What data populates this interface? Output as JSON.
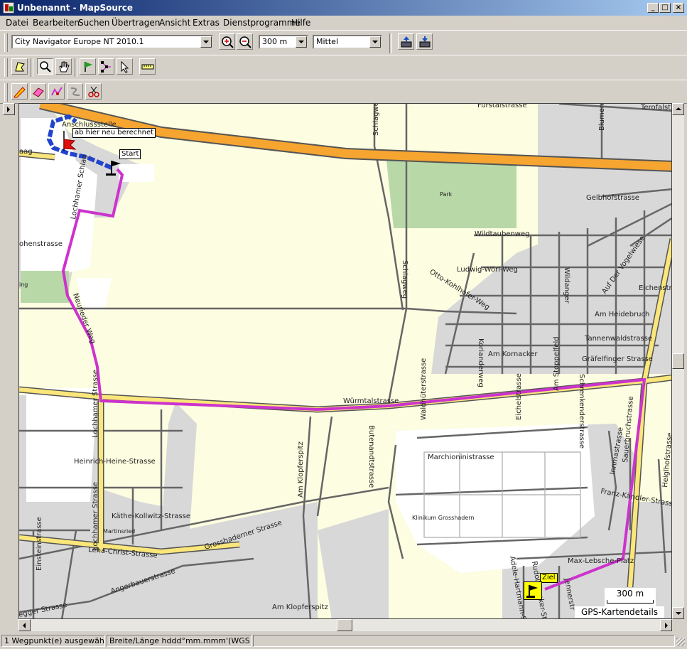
{
  "window": {
    "title": "Unbenannt - MapSource",
    "min": "_",
    "max": "□",
    "close": "×"
  },
  "menu": [
    "Datei",
    "Bearbeiten",
    "Suchen",
    "Übertragen",
    "Ansicht",
    "Extras",
    "Dienstprogramme",
    "Hilfe"
  ],
  "toolbar": {
    "map_product": "City Navigator Europe NT 2010.1",
    "zoom_scale": "300 m",
    "detail": "Mittel"
  },
  "icons": {
    "zoom_in": "zoom-in-icon",
    "zoom_out": "zoom-out-icon",
    "send": "send-to-device-icon",
    "receive": "receive-from-device-icon"
  },
  "map": {
    "tags": {
      "recalc": "ab hier neu berechnet",
      "start": "Start",
      "ziel": "Ziel"
    },
    "labels": {
      "anschlussstelle": "Anschlussstelle",
      "schlagweg_top": "Schlagweg",
      "fuerstalstrasse": "Fürstalstrasse",
      "terofalstr": "Terofalstr",
      "blumen": "Blumen",
      "park": "Park",
      "gelbhofstrasse": "Gelbhofstrasse",
      "wildtaubenweg": "Wildtaubenweg",
      "ludwig": "Ludwig-Wörl-Weg",
      "otto": "Otto-Kohlhofer-Weg",
      "wildanger": "Wildanger",
      "vogelwiese": "Auf Der Vogelwiese",
      "eichenstr": "Eichenstr",
      "am_heidebruch": "Am Heidebruch",
      "tannenwald": "Tannenwaldstrasse",
      "am_kornacker": "Am Kornacker",
      "graefelfinger": "Gräfelfinger Strasse",
      "schlagweg_mid": "Schlagweg",
      "lochhamer_schlag": "Lochhamer Schlag",
      "ohenstrasse": "ohenstrasse",
      "aag": "aag",
      "ing": "ing",
      "neurieder": "Neurieder Weg",
      "wuermtal": "Würmtalstrasse",
      "waldhueter": "Waldhüterstrasse",
      "koriander": "Korianderweg",
      "eichelstrasse": "Eichelstrasse",
      "am_stoppelfeld": "Am Stoppelfeld",
      "schrenk": "Schrenkenderstrasse",
      "lochhamer_strasse_1": "Lochhamer Strasse",
      "lochhamer_strasse_2": "Lochhamer Strasse",
      "butenandt": "Butenandtstrasse",
      "marchioni": "Marchioninistrasse",
      "heinrich": "Heinrich-Heine-Strasse",
      "am_klopferspitz_1": "Am Klopferspitz",
      "am_klopferspitz_2": "Am Klopferspitz",
      "kaethe": "Käthe-Kollwitz-Strasse",
      "martinsried": "Martinsried",
      "klinikum": "Klinikum Grosshadern",
      "grosshaderner": "Grosshaderner Strasse",
      "lena": "Lena-Christ-Strasse",
      "einstein": "Einsteinstrasse",
      "angerbauer": "Angerbauerstrasse",
      "egger": "egger Strasse",
      "innmaster": "Innmastrasse",
      "sauerbruch": "Sauerbruchstrasse",
      "heiglhof": "Heiglhofstrasse",
      "franz": "Franz-Kändler-Strasse",
      "max": "Max-Lebsche-Platz",
      "adele": "Adele-Hartmann-S",
      "rudolf": "Rudolf-Zenker-Str",
      "jennerstr": "Jennerstr"
    },
    "scale": "300 m",
    "gps_details": "GPS-Kartendetails"
  },
  "status": {
    "left": "1 Wegpunkt(e) ausgewählt",
    "middle": "Breite/Länge hddd°mm.mmm'(WGS 84)",
    "right": ""
  },
  "colors": {
    "route": "#cc33cc",
    "route_recalc": "#2244cc",
    "motorway": "#f5a530",
    "main_road": "#fae67a",
    "park": "#b8d8a8",
    "residential": "#d8d8d8",
    "background": "#fdfde1"
  }
}
